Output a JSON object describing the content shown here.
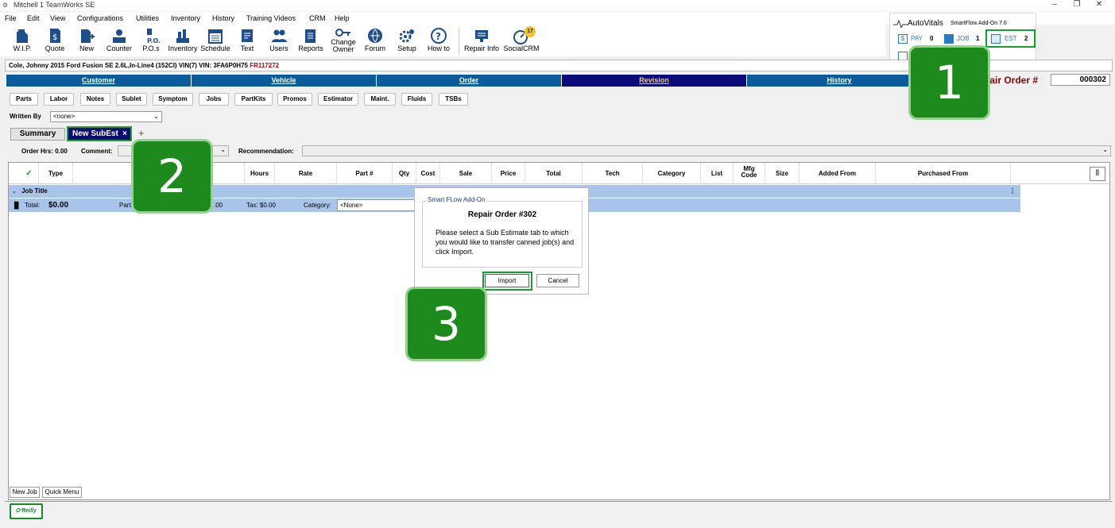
{
  "window": {
    "title": "Mitchell 1 TeamWorks SE",
    "controls": [
      "–",
      "❐",
      "✕"
    ]
  },
  "menu": [
    "File",
    "Edit",
    "View",
    "Configurations",
    "Utilities",
    "Inventory",
    "History",
    "Training Videos",
    "CRM",
    "Help"
  ],
  "toolbar": [
    {
      "label": "W.I.P.",
      "icon": "wip-icon"
    },
    {
      "label": "Quote",
      "icon": "quote-icon"
    },
    {
      "label": "New",
      "icon": "new-icon"
    },
    {
      "label": "Counter",
      "icon": "counter-icon"
    },
    {
      "label": "P.O.s",
      "icon": "po-icon"
    },
    {
      "label": "Inventory",
      "icon": "inventory-icon"
    },
    {
      "label": "Schedule",
      "icon": "schedule-icon"
    },
    {
      "label": "Text",
      "icon": "text-icon"
    },
    {
      "label": "Users",
      "icon": "users-icon"
    },
    {
      "label": "Reports",
      "icon": "reports-icon"
    },
    {
      "label": "Change\nOwner",
      "icon": "change-owner-icon"
    },
    {
      "label": "Forum",
      "icon": "forum-icon"
    },
    {
      "label": "Setup",
      "icon": "setup-icon"
    },
    {
      "label": "How to",
      "icon": "how-to-icon"
    },
    {
      "label": "Repair Info",
      "icon": "repair-info-icon"
    },
    {
      "label": "SocialCRM",
      "icon": "social-crm-icon",
      "badge": "17"
    }
  ],
  "autovitals": {
    "brand": "AutoVitals",
    "version": "SmartFlow Add-On 7.6",
    "pay_label": "PAY",
    "pay_count": "0",
    "job_label": "JOB",
    "job_count": "1",
    "est_label": "EST",
    "est_count": "2"
  },
  "customer_bar": {
    "text": "Cole, Johnny   2015  Ford Fusion SE  2.6L,In-Line4 (152CI) VIN(7)   VIN: 3FA6P0H75 ",
    "vin_tail": "FR117272"
  },
  "nav_tabs": [
    "Customer",
    "Vehicle",
    "Order",
    "Revision",
    "History"
  ],
  "repair_order": {
    "label": "pair Order #",
    "number": "000302"
  },
  "sub_buttons": [
    "Parts",
    "Labor",
    "Notes",
    "Sublet",
    "Symptom",
    "Jobs",
    "PartKits",
    "Promos",
    "Estimator",
    "Maint.",
    "Fluids",
    "TSBs"
  ],
  "written_by": {
    "label": "Written By",
    "value": "<none>"
  },
  "estimate_tabs": {
    "summary": "Summary",
    "active": "New SubEst",
    "close": "×",
    "add": "+"
  },
  "order_info": {
    "order_hrs": "Order Hrs: 0.00",
    "comment_label": "Comment:",
    "recommendation_label": "Recommendation:"
  },
  "grid": {
    "columns": [
      "Type",
      "Hours",
      "Rate",
      "Part #",
      "Qty",
      "Cost",
      "Sale",
      "Price",
      "Total",
      "Tech",
      "Category",
      "List",
      "Mfg\nCode",
      "Size",
      "Added From",
      "Purchased From"
    ],
    "job_title": "Job Title",
    "total_label": "Total:",
    "total_value": "$0.00",
    "parts_label": "Parts",
    "amount": ".00",
    "tax": "Tax: $0.00",
    "category_label": "Category:",
    "category_value": "<None>"
  },
  "bottom_buttons": {
    "new_job": "New Job",
    "quick_menu": "Quick Menu"
  },
  "footer_logo": "O'Reilly",
  "dialog": {
    "group_title": "Smart FLow Add-On",
    "title": "Repair Order #302",
    "message": "Please select a Sub Estimate tab to which you would like to transfer canned job(s) and click Import.",
    "import_label": "Import",
    "cancel_label": "Cancel"
  },
  "callouts": [
    "1",
    "2",
    "3"
  ],
  "colors": {
    "nav_tab": "#0b5a9a",
    "nav_tab_active": "#0a0a78",
    "highlight_green": "#16a034",
    "callout_green": "#1e8a1e",
    "grid_row": "#a9c4ea"
  }
}
